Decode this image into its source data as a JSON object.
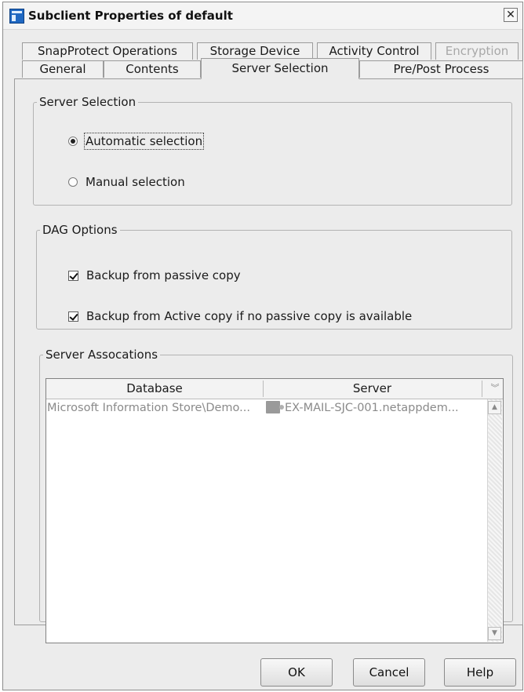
{
  "window": {
    "title": "Subclient Properties of default",
    "close_glyph": "✕"
  },
  "tabs": {
    "row1": [
      {
        "label": "SnapProtect Operations",
        "disabled": false
      },
      {
        "label": "Storage Device",
        "disabled": false
      },
      {
        "label": "Activity Control",
        "disabled": false
      },
      {
        "label": "Encryption",
        "disabled": true
      }
    ],
    "row2": [
      {
        "label": "General"
      },
      {
        "label": "Contents"
      },
      {
        "label": "Server Selection",
        "active": true
      },
      {
        "label": "Pre/Post Process"
      }
    ]
  },
  "server_selection": {
    "legend": "Server Selection",
    "automatic_label": "Automatic selection",
    "manual_label": "Manual selection",
    "selected": "automatic"
  },
  "dag_options": {
    "legend": "DAG Options",
    "passive_label": "Backup from passive copy",
    "passive_checked": true,
    "active_label": "Backup from Active copy if no passive copy is available",
    "active_checked": true
  },
  "server_associations": {
    "legend": "Server Assocations",
    "columns": [
      "Database",
      "Server"
    ],
    "rows": [
      {
        "database": "Microsoft Information Store\\Demo...",
        "server": "EX-MAIL-SJC-001.netappdem..."
      }
    ]
  },
  "buttons": {
    "ok": "OK",
    "cancel": "Cancel",
    "help": "Help"
  },
  "icons": {
    "window": "app-window-icon",
    "server": "server-icon",
    "sort": "sort-chevrons-icon",
    "scroll_up": "scroll-up-arrow-icon",
    "scroll_down": "scroll-down-arrow-icon"
  }
}
